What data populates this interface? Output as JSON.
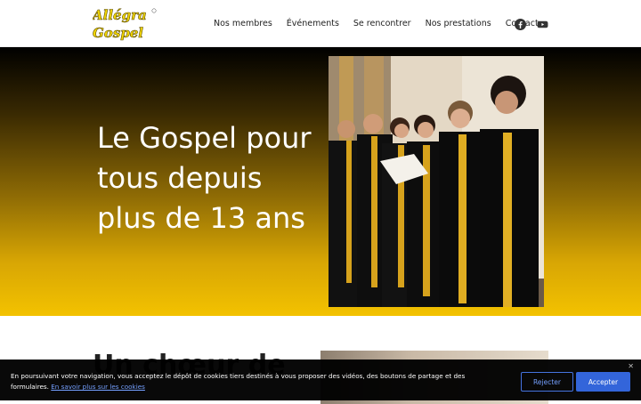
{
  "header": {
    "logo_line1": "Allégra",
    "logo_line2": "Gospel",
    "nav": [
      {
        "label": "Nos membres"
      },
      {
        "label": "Événements"
      },
      {
        "label": "Se rencontrer"
      },
      {
        "label": "Nos prestations"
      },
      {
        "label": "Contact"
      }
    ],
    "social_icons": [
      "facebook-icon",
      "youtube-icon"
    ]
  },
  "hero": {
    "title": "Le Gospel pour tous depuis plus de 13 ans"
  },
  "section2": {
    "heading": "Un chœur de"
  },
  "cookie_banner": {
    "text": "En poursuivant votre navigation, vous acceptez le dépôt de cookies tiers destinés à vous proposer des vidéos, des boutons de partage et des formulaires.",
    "learn_more": "En savoir plus sur les cookies",
    "reject_label": "Rejecter",
    "accept_label": "Accepter",
    "close_icon": "close-icon"
  },
  "colors": {
    "hero_gradient_top": "#000000",
    "hero_gradient_bottom": "#f3c200",
    "logo_yellow": "#f2d600",
    "accent_blue": "#2b5fd9"
  }
}
